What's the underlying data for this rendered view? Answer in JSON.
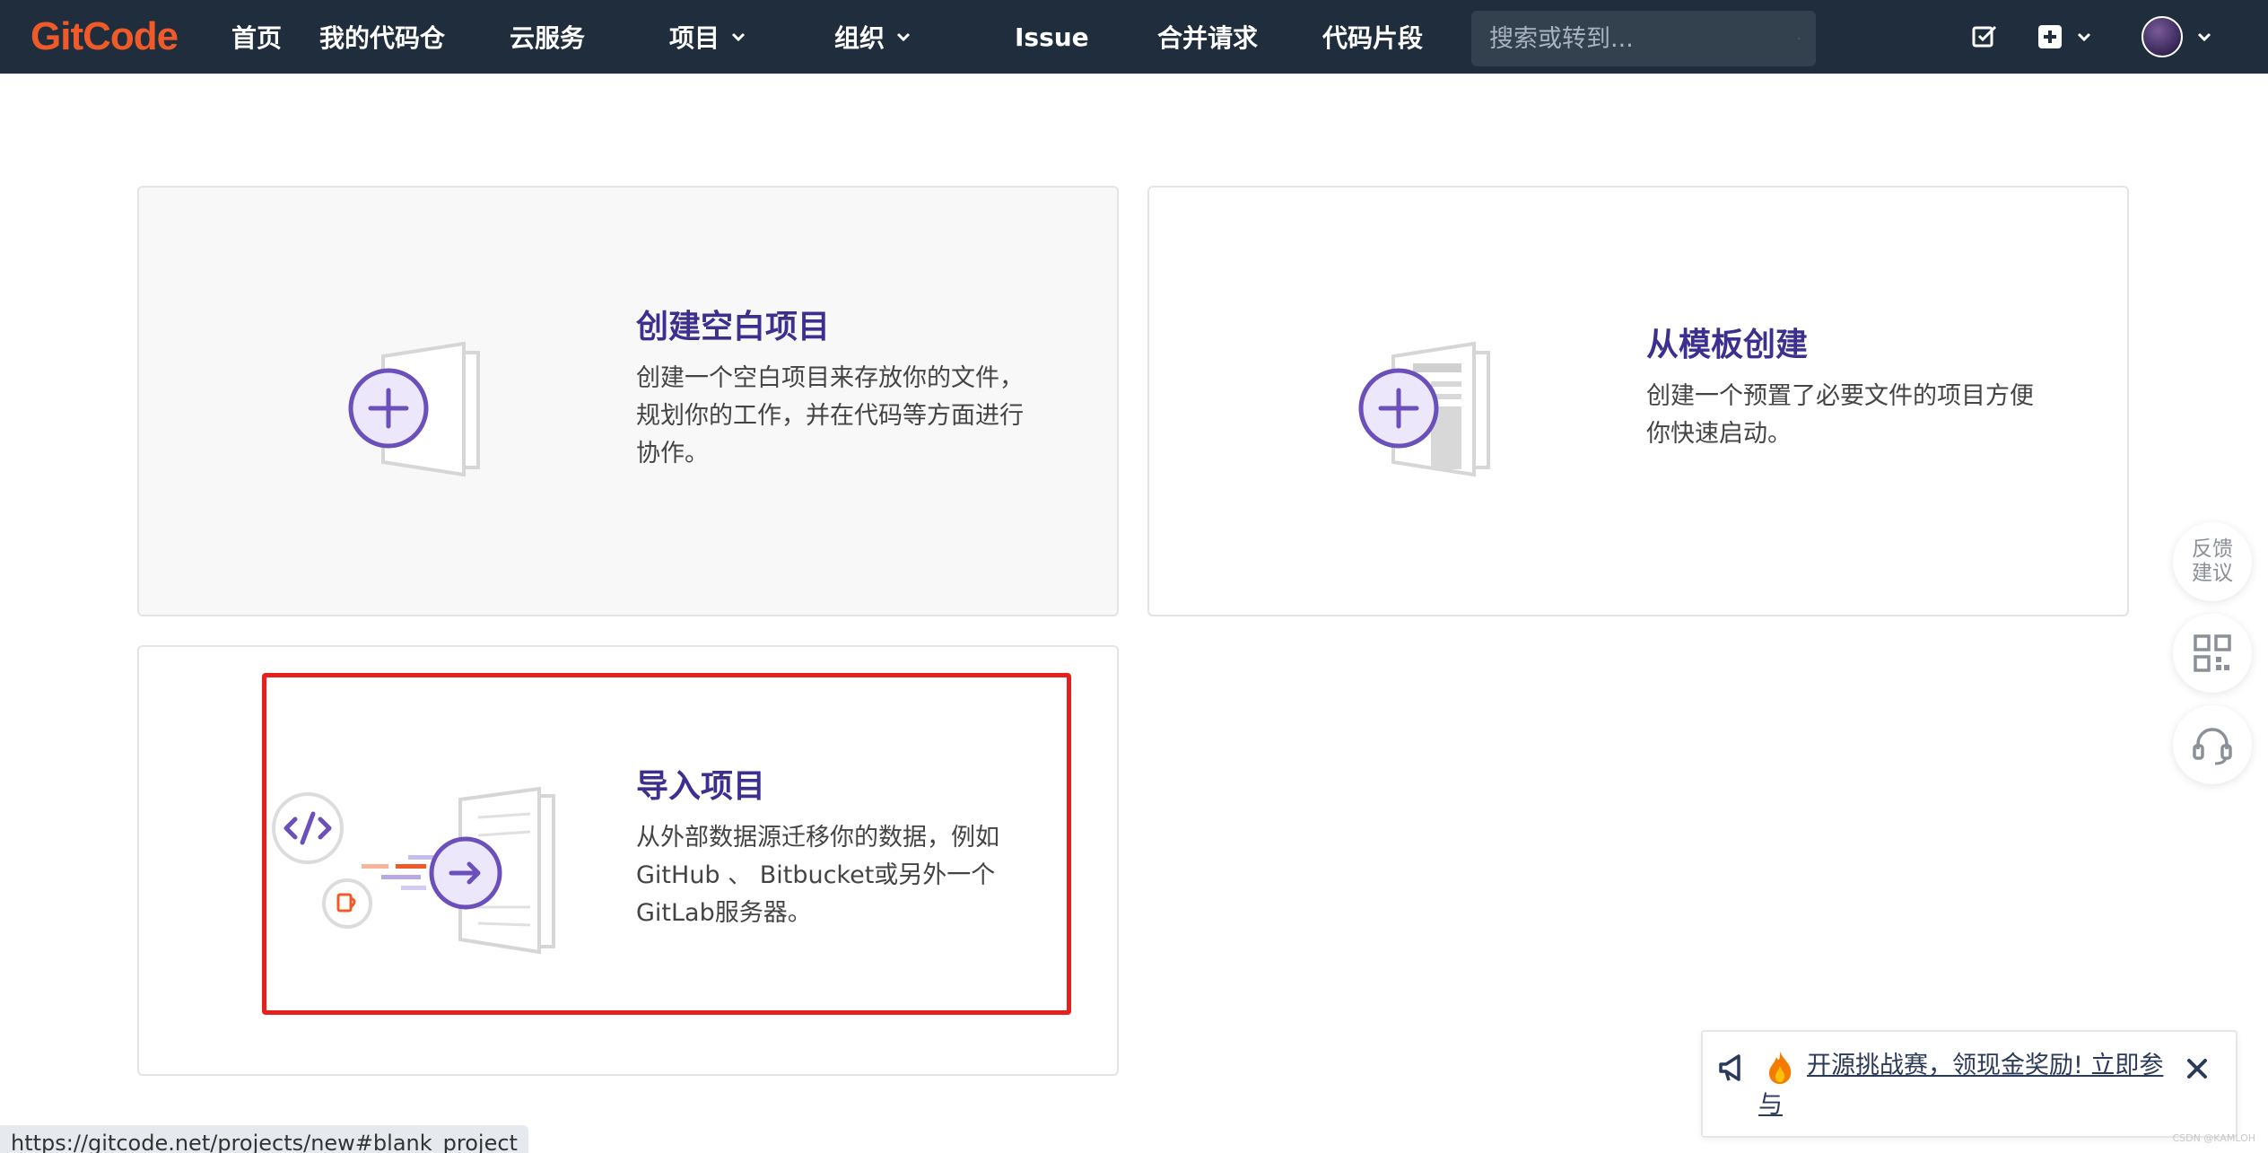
{
  "nav": {
    "logo": "GitCode",
    "items": [
      "首页",
      "我的代码仓",
      "云服务",
      "项目",
      "组织",
      "Issue",
      "合并请求",
      "代码片段"
    ],
    "search_placeholder": "搜索或转到..."
  },
  "cards": [
    {
      "title": "创建空白项目",
      "desc": "创建一个空白项目来存放你的文件，规划你的工作，并在代码等方面进行协作。"
    },
    {
      "title": "从模板创建",
      "desc": "创建一个预置了必要文件的项目方便你快速启动。"
    },
    {
      "title": "导入项目",
      "desc": "从外部数据源迁移你的数据，例如 GitHub 、 Bitbucket或另外一个 GitLab服务器。"
    }
  ],
  "float": {
    "feedback": "反馈建议"
  },
  "notice": {
    "text": "开源挑战赛，领现金奖励! 立即参与"
  },
  "status_url": "https://gitcode.net/projects/new#blank_project",
  "watermark": "CSDN @KAMLOH",
  "colors": {
    "topbar": "#1f2d3d",
    "brand": "#f05a28",
    "title": "#3d2f8f",
    "accent": "#6b4fbb",
    "highlight": "#e8201c"
  }
}
